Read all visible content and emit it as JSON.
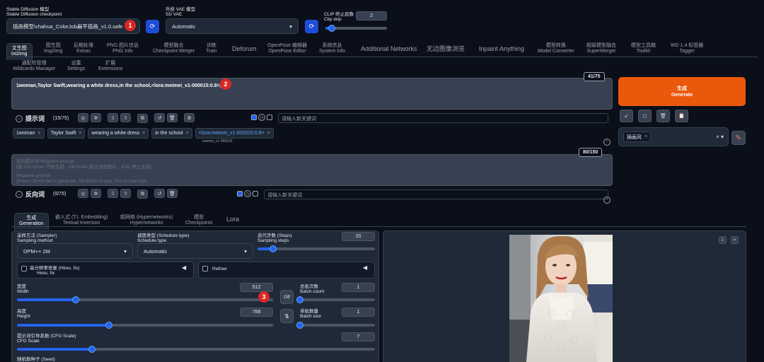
{
  "header": {
    "sd_model_label": "Stable Diffusion 模型",
    "sd_model_label_en": "Stable Diffusion checkpoint",
    "sd_model_value": "插画模型\\chahua_ColorJob扁平插画_v1.0.safe",
    "vae_label": "外挂 VAE 模型",
    "vae_label_en": "SD VAE",
    "vae_value": "Automatic",
    "clip_label": "CLIP 终止层数",
    "clip_label_en": "Clip skip",
    "clip_value": "2",
    "clip_fraction": 0.1
  },
  "tabs_row1": [
    {
      "cn": "文生图",
      "en": "txt2img"
    },
    {
      "cn": "图生图",
      "en": "img2img"
    },
    {
      "cn": "后期处理",
      "en": "Extras"
    },
    {
      "cn": "PNG 图片信息",
      "en": "PNG Info"
    },
    {
      "cn": "模型融合",
      "en": "Checkpoint Merger"
    },
    {
      "cn": "训练",
      "en": "Train"
    },
    {
      "cn": "Deforum",
      "en": ""
    },
    {
      "cn": "OpenPose 编辑器",
      "en": "OpenPose Editor"
    },
    {
      "cn": "系统信息",
      "en": "System Info"
    },
    {
      "cn": "Additional Networks",
      "en": ""
    },
    {
      "cn": "无边图像浏览",
      "en": ""
    },
    {
      "cn": "Inpaint Anything",
      "en": ""
    },
    {
      "cn": "模型转换",
      "en": "Model Converter"
    },
    {
      "cn": "超级模型融合",
      "en": "SuperMerger"
    },
    {
      "cn": "模型工具箱",
      "en": "Toolkit"
    },
    {
      "cn": "WD 1.4 标签器",
      "en": "Tagger"
    }
  ],
  "tabs_row2": [
    {
      "cn": "通配符管理",
      "en": "Wildcards Manager"
    },
    {
      "cn": "设置",
      "en": "Settings"
    },
    {
      "cn": "扩展",
      "en": "Extensions"
    }
  ],
  "prompt": {
    "text": "1woman,Taylor Swift,wearing a white dress,in the school,<lora:meimei_v1-000015:0.8>,",
    "counter": "41/75",
    "label": "提示词",
    "count": "(15/75)",
    "keyword_placeholder": "请输入新关键词",
    "tags": [
      "1woman",
      "Taylor Swift",
      "wearing a white dress",
      "in the school",
      "<lora:meimei_v1-000015:0.8>"
    ],
    "lora_subtitle": "meimei_v1-000015"
  },
  "negative": {
    "placeholder_cn": "反向提示词 Negative prompt",
    "placeholder_cn2": "(按 Ctrl+Enter 开始生成，Alt+Enter 跳过当前图片，ESC 停止生成)",
    "placeholder_en": "Negative prompt",
    "placeholder_en2": "(Press Ctrl+Enter to generate, Alt+Enter to skip, Esc to interrupt)",
    "counter": "80/150",
    "label": "反向词",
    "count": "(0/75)",
    "keyword_placeholder": "请输入新关键词"
  },
  "generate": {
    "cn": "生成",
    "en": "Generate",
    "style_tag": "插画风"
  },
  "gen_tabs": [
    {
      "cn": "生成",
      "en": "Generation"
    },
    {
      "cn": "嵌入式 (T.I. Embedding)",
      "en": "Textual Inversion"
    },
    {
      "cn": "超网络 (Hypernetworks)",
      "en": "Hypernetworks"
    },
    {
      "cn": "模型",
      "en": "Checkpoints"
    },
    {
      "cn": "Lora",
      "en": ""
    }
  ],
  "settings": {
    "sampler_label": "采样方法 (Sampler)",
    "sampler_label_en": "Sampling method",
    "sampler_value": "DPM++ 2M",
    "schedule_label": "调度类型 (Schedule type)",
    "schedule_label_en": "Schedule type",
    "schedule_value": "Automatic",
    "steps_label": "迭代步数 (Steps)",
    "steps_label_en": "Sampling steps",
    "steps_value": "20",
    "steps_fraction": 0.13,
    "hires_label": "高分辨率修复 (Hires. fix)",
    "hires_label_en": "Hires. fix",
    "refiner_label": "Refiner",
    "width_label": "宽度",
    "width_label_en": "Width",
    "width_value": "512",
    "width_fraction": 0.23,
    "height_label": "高度",
    "height_label_en": "Height",
    "height_value": "768",
    "height_fraction": 0.36,
    "batch_count_label": "总批次数",
    "batch_count_label_en": "Batch count",
    "batch_count_value": "1",
    "batch_size_label": "单批数量",
    "batch_size_label_en": "Batch size",
    "batch_size_value": "1",
    "cfg_label": "提示词引导系数 (CFG Scale)",
    "cfg_label_en": "CFG Scale",
    "cfg_value": "7",
    "cfg_fraction": 0.21,
    "seed_label": "随机数种子 (Seed)",
    "off_label": "Off"
  },
  "badges": [
    "1",
    "2",
    "3"
  ]
}
